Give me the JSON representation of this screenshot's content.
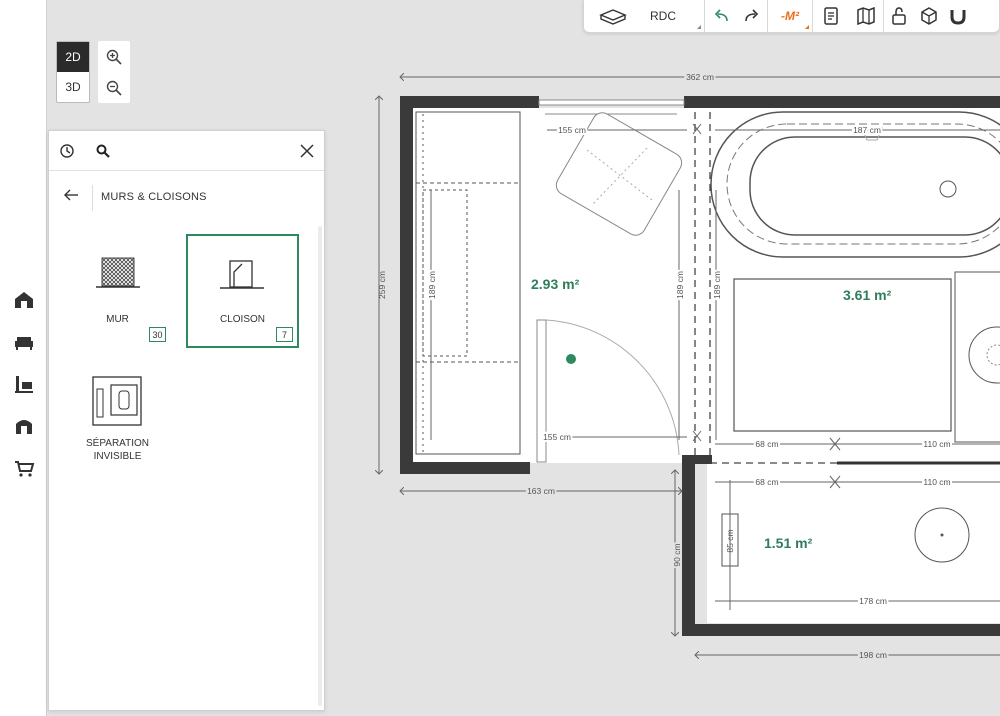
{
  "toolbar": {
    "level_label": "RDC",
    "m2_label": "-M²",
    "icons": [
      "floor-icon",
      "undo-icon",
      "redo-icon",
      "measure-icon",
      "document-icon",
      "map-icon",
      "lock-icon",
      "cube-icon",
      "magnet-icon"
    ]
  },
  "view_modes": {
    "mode_2d": "2D",
    "mode_3d": "3D",
    "active": "2D"
  },
  "side_nav": [
    "house-icon",
    "sofa-icon",
    "lamp-icon",
    "door-icon",
    "cart-icon"
  ],
  "panel": {
    "category_title": "MURS & CLOISONS",
    "items": [
      {
        "label": "MUR",
        "count": "30",
        "selected": false
      },
      {
        "label": "CLOISON",
        "count": "7",
        "selected": true
      },
      {
        "label_line1": "SÉPARATION",
        "label_line2": "INVISIBLE"
      }
    ]
  },
  "plan": {
    "rooms": [
      {
        "area": "2.93 m²"
      },
      {
        "area": "3.61 m²"
      },
      {
        "area": "1.51 m²"
      }
    ],
    "dimensions": {
      "total_width": "362 cm",
      "left_height": "259 cm",
      "left_room_width": "163 cm",
      "top_inner_left": "155 cm",
      "top_inner_right": "187 cm",
      "cabinet_height": "189 cm",
      "middle_height_a": "189 cm",
      "middle_height_b": "189 cm",
      "bottom_inner_left": "155 cm",
      "mid_a_left": "68 cm",
      "mid_a_right": "110 cm",
      "mid_b_left": "68 cm",
      "mid_b_right": "110 cm",
      "small_height": "90 cm",
      "item_height": "85 cm",
      "small_room_width": "178 cm",
      "bottom_width": "198 cm"
    }
  },
  "colors": {
    "accent": "#2e8a5e",
    "area_text": "#2e7d5b",
    "wall": "#3a3a3a",
    "canvas_bg": "#e3e3e3",
    "orange": "#e8701a"
  }
}
